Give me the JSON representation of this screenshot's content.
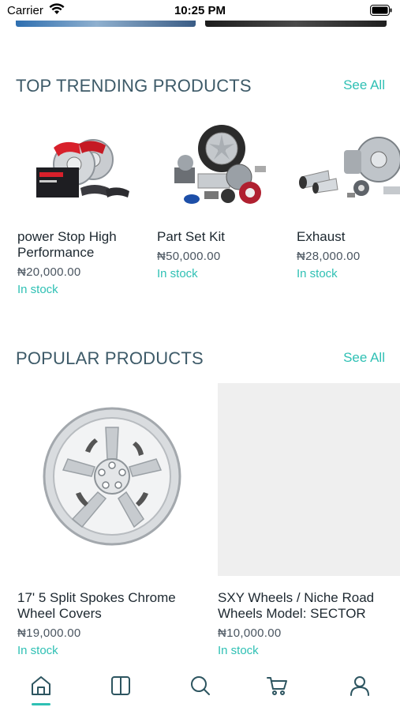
{
  "status_bar": {
    "carrier": "Carrier",
    "time": "10:25 PM"
  },
  "trending": {
    "title": "TOP TRENDING PRODUCTS",
    "see_all": "See All",
    "items": [
      {
        "name": "power Stop High Performance",
        "price": "₦20,000.00",
        "stock": "In stock"
      },
      {
        "name": "Part Set Kit",
        "price": "₦50,000.00",
        "stock": "In stock"
      },
      {
        "name": "Exhaust",
        "price": "₦28,000.00",
        "stock": "In stock"
      }
    ]
  },
  "popular": {
    "title": "POPULAR PRODUCTS",
    "see_all": "See All",
    "items": [
      {
        "name": "17' 5 Split Spokes Chrome Wheel Covers",
        "price": "₦19,000.00",
        "stock": "In stock"
      },
      {
        "name": "SXY Wheels / Niche Road Wheels Model: SECTOR",
        "price": "₦10,000.00",
        "stock": "In stock"
      }
    ]
  },
  "tab_bar": {
    "icons": [
      "home-icon",
      "catalog-icon",
      "search-icon",
      "cart-icon",
      "profile-icon"
    ],
    "active_color": "#2fc0b4"
  },
  "colors": {
    "accent": "#2fc0b4",
    "heading": "#3d5a68"
  }
}
